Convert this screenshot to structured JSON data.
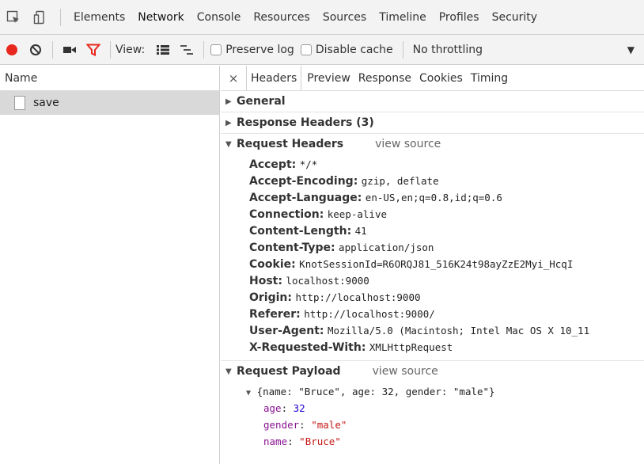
{
  "main_tabs": [
    "Elements",
    "Network",
    "Console",
    "Resources",
    "Sources",
    "Timeline",
    "Profiles",
    "Security"
  ],
  "toolbar": {
    "view_label": "View:",
    "preserve_log": "Preserve log",
    "disable_cache": "Disable cache",
    "throttling": "No throttling"
  },
  "requests": {
    "header": "Name",
    "items": [
      "save"
    ]
  },
  "detail_tabs": [
    "Headers",
    "Preview",
    "Response",
    "Cookies",
    "Timing"
  ],
  "sections": {
    "general": "General",
    "response_headers": "Response Headers (3)",
    "request_headers": "Request Headers",
    "view_source": "view source",
    "request_payload": "Request Payload"
  },
  "request_headers": [
    {
      "key": "Accept:",
      "value": "*/*"
    },
    {
      "key": "Accept-Encoding:",
      "value": "gzip, deflate"
    },
    {
      "key": "Accept-Language:",
      "value": "en-US,en;q=0.8,id;q=0.6"
    },
    {
      "key": "Connection:",
      "value": "keep-alive"
    },
    {
      "key": "Content-Length:",
      "value": "41"
    },
    {
      "key": "Content-Type:",
      "value": "application/json"
    },
    {
      "key": "Cookie:",
      "value": "KnotSessionId=R6ORQJ81_516K24t98ayZzE2Myi_HcqI"
    },
    {
      "key": "Host:",
      "value": "localhost:9000"
    },
    {
      "key": "Origin:",
      "value": "http://localhost:9000"
    },
    {
      "key": "Referer:",
      "value": "http://localhost:9000/"
    },
    {
      "key": "User-Agent:",
      "value": "Mozilla/5.0 (Macintosh; Intel Mac OS X 10_11"
    },
    {
      "key": "X-Requested-With:",
      "value": "XMLHttpRequest"
    }
  ],
  "payload": {
    "summary": "{name: \"Bruce\", age: 32, gender: \"male\"}",
    "fields": [
      {
        "key": "age",
        "value": "32",
        "type": "number"
      },
      {
        "key": "gender",
        "value": "\"male\"",
        "type": "string"
      },
      {
        "key": "name",
        "value": "\"Bruce\"",
        "type": "string"
      }
    ]
  },
  "colors": {
    "record": "#e8281e",
    "filter": "#e8281e",
    "payload_key": "#881391",
    "payload_number": "#1c00cf",
    "payload_string": "#c41a16"
  }
}
